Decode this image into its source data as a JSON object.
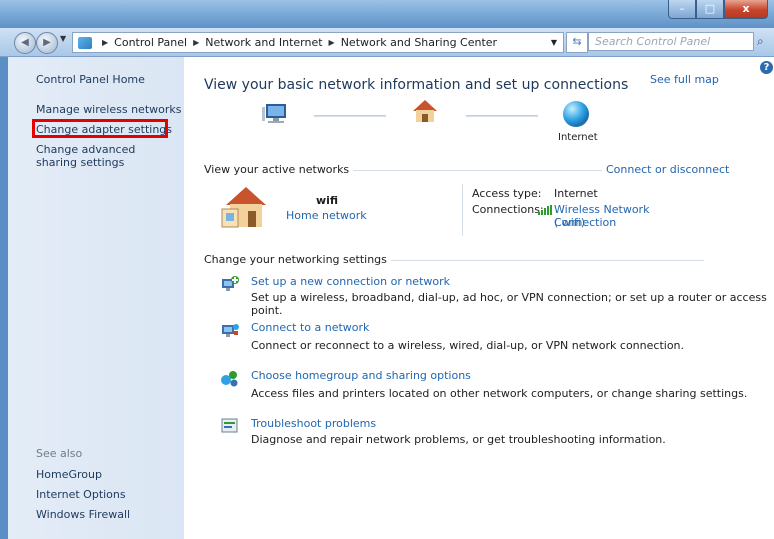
{
  "address": {
    "crumbs": [
      "Control Panel",
      "Network and Internet",
      "Network and Sharing Center"
    ],
    "search_placeholder": "Search Control Panel"
  },
  "caption": {
    "minimize": "–",
    "maximize": "□",
    "close": "x"
  },
  "left_pane": {
    "home": "Control Panel Home",
    "items": [
      "Manage wireless networks",
      "Change adapter settings",
      "Change advanced sharing settings"
    ],
    "see_also_label": "See also",
    "see_also": [
      "HomeGroup",
      "Internet Options",
      "Windows Firewall"
    ]
  },
  "main": {
    "title": "View your basic network information and set up connections",
    "see_full_map": "See full map",
    "internet_label": "Internet",
    "active_networks_label": "View your active networks",
    "connect_or_disconnect": "Connect or disconnect",
    "network": {
      "name": "wifi",
      "type": "Home network",
      "access_type_label": "Access type:",
      "access_type_value": "Internet",
      "connections_label": "Connections:",
      "connection_name": "Wireless Network Connection",
      "connection_ssid": "(        wifi)"
    },
    "change_settings_label": "Change your networking settings",
    "tasks": [
      {
        "link": "Set up a new connection or network",
        "desc": "Set up a wireless, broadband, dial-up, ad hoc, or VPN connection; or set up a router or access point."
      },
      {
        "link": "Connect to a network",
        "desc": "Connect or reconnect to a wireless, wired, dial-up, or VPN network connection."
      },
      {
        "link": "Choose homegroup and sharing options",
        "desc": "Access files and printers located on other network computers, or change sharing settings."
      },
      {
        "link": "Troubleshoot problems",
        "desc": "Diagnose and repair network problems, or get troubleshooting information."
      }
    ]
  },
  "colors": {
    "link": "#2166b0",
    "highlight": "#e60000",
    "titlebar": "#7eacd9"
  }
}
